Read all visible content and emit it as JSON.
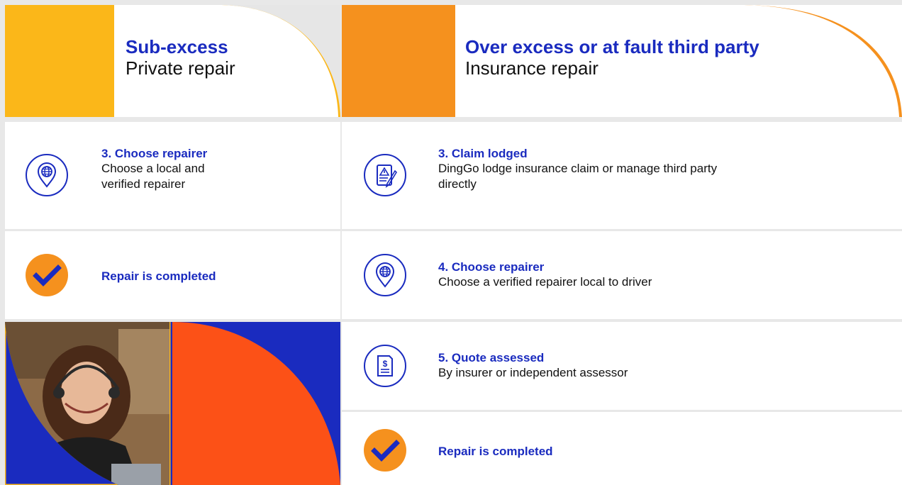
{
  "left_header": {
    "title": "Sub-excess",
    "subtitle": "Private repair"
  },
  "right_header": {
    "title": "Over excess or at fault third party",
    "subtitle": "Insurance repair"
  },
  "left_steps": [
    {
      "title": "3. Choose repairer",
      "desc_line1": "Choose a local and",
      "desc_line2": "verified repairer",
      "icon": "location-globe-icon"
    },
    {
      "title": "Repair is completed",
      "icon": "check-icon"
    }
  ],
  "right_steps": [
    {
      "title": "3. Claim lodged",
      "desc_line1": "DingGo lodge insurance claim or manage third party",
      "desc_line2": "directly",
      "icon": "claim-form-icon"
    },
    {
      "title": "4. Choose repairer",
      "desc_line1": "Choose a verified repairer local to driver",
      "icon": "location-globe-icon"
    },
    {
      "title": "5. Quote assessed",
      "desc_line1": "By insurer or independent assessor",
      "icon": "quote-document-icon"
    },
    {
      "title": "Repair is completed",
      "icon": "check-icon"
    }
  ],
  "colors": {
    "brand_blue": "#1a2bbf",
    "accent_yellow": "#fbb719",
    "accent_orange": "#f5911e",
    "accent_red_orange": "#fc5117"
  }
}
